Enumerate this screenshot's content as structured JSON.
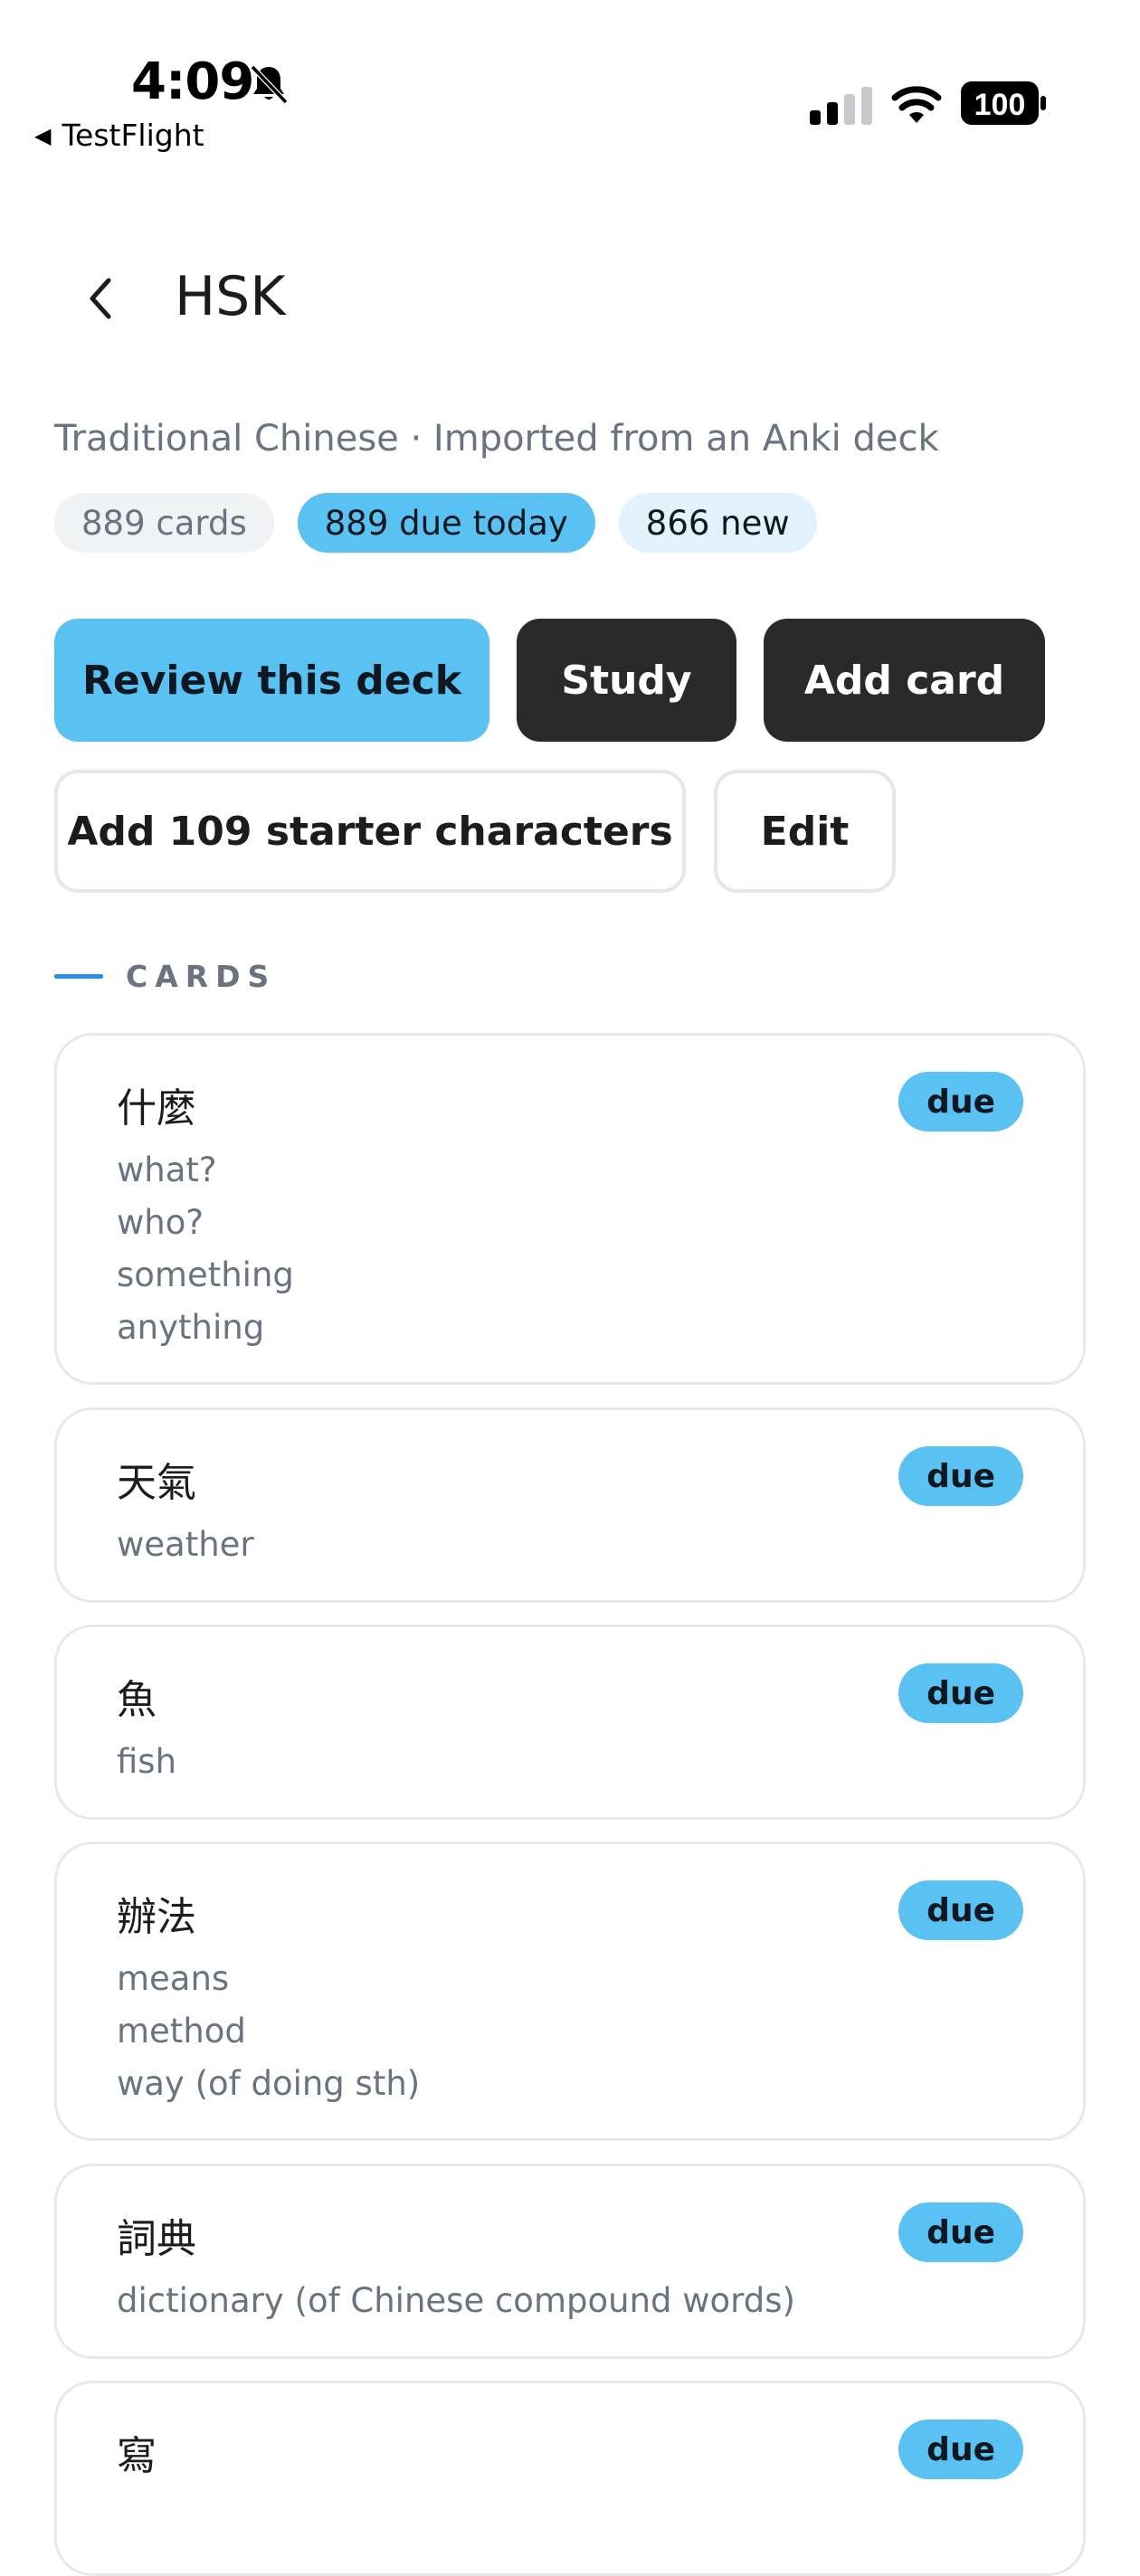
{
  "status_bar": {
    "time": "4:09",
    "back_app": "TestFlight",
    "battery": "100",
    "icons": [
      "bell-slash-icon",
      "cellular-signal-icon",
      "wifi-icon",
      "battery-icon"
    ]
  },
  "header": {
    "title": "HSK",
    "back_icon": "chevron-left-icon"
  },
  "deck_info": {
    "subtitle": "Traditional Chinese  ·  Imported from an Anki deck",
    "pills": {
      "cards": "889 cards",
      "due": "889 due today",
      "new": "866 new"
    }
  },
  "actions": {
    "review": "Review this deck",
    "study": "Study",
    "add_card": "Add card",
    "starter": "Add 109 starter characters",
    "edit": "Edit"
  },
  "section": {
    "label": "CARDS"
  },
  "cards": [
    {
      "hanzi": "什麼",
      "badge": "due",
      "defs": [
        "what?",
        "who?",
        "something",
        "anything"
      ]
    },
    {
      "hanzi": "天氣",
      "badge": "due",
      "defs": [
        "weather"
      ]
    },
    {
      "hanzi": "魚",
      "badge": "due",
      "defs": [
        "fish"
      ]
    },
    {
      "hanzi": "辦法",
      "badge": "due",
      "defs": [
        "means",
        "method",
        "way (of doing sth)"
      ]
    },
    {
      "hanzi": "詞典",
      "badge": "due",
      "defs": [
        "dictionary (of Chinese compound words)"
      ]
    },
    {
      "hanzi": "寫",
      "badge": "due",
      "defs": []
    }
  ],
  "colors": {
    "accent_blue": "#5ac1f3",
    "dark_button": "#2a2a2a",
    "section_bar": "#2b90e3",
    "muted_text": "#6b7280"
  }
}
